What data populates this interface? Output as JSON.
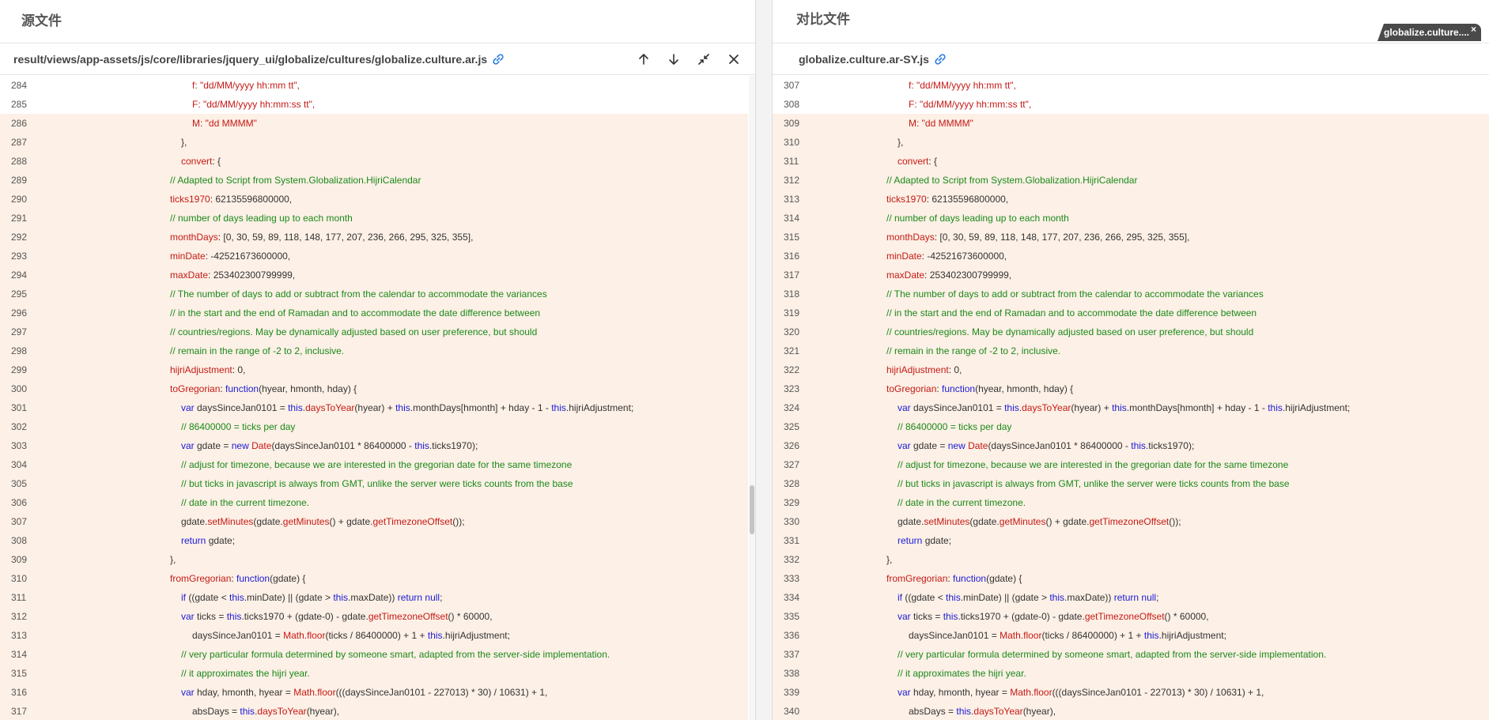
{
  "left": {
    "title": "源文件",
    "file_path": "result/views/app-assets/js/core/libraries/jquery_ui/globalize/cultures/globalize.culture.ar.js",
    "first_line": 284,
    "tooltips": {
      "prev": "上一处差异",
      "next": "下一处差异",
      "collapse": "折叠",
      "close": "关闭"
    }
  },
  "right": {
    "title": "对比文件",
    "file_path": "globalize.culture.ar-SY.js",
    "first_line": 307
  },
  "file_tab": {
    "label": "globalize.culture....",
    "close": "×"
  },
  "colors": {
    "highlight": "#fdf0e6",
    "marker_yellow": "#f2b705",
    "marker_red": "#f0666a",
    "keyword": "#1a1ad6",
    "property": "#c41a16",
    "comment": "#1a8a1a"
  },
  "icons": [
    "link-icon",
    "arrow-up-icon",
    "arrow-down-icon",
    "collapse-icon",
    "close-icon"
  ],
  "lines": [
    {
      "indent": 3,
      "segs": [
        [
          "st",
          "f: \"dd/MM/yyyy hh:mm tt\","
        ]
      ]
    },
    {
      "indent": 3,
      "segs": [
        [
          "st",
          "F: \"dd/MM/yyyy hh:mm:ss tt\","
        ]
      ]
    },
    {
      "indent": 3,
      "segs": [
        [
          "st",
          "M: \"dd MMMM\""
        ]
      ]
    },
    {
      "indent": 2,
      "segs": [
        [
          "pl",
          "},"
        ]
      ]
    },
    {
      "indent": 2,
      "segs": [
        [
          "pr",
          "convert"
        ],
        [
          "pl",
          ": {"
        ]
      ]
    },
    {
      "indent": 1,
      "segs": [
        [
          "cm",
          "// Adapted to Script from System.Globalization.HijriCalendar"
        ]
      ]
    },
    {
      "indent": 1,
      "segs": [
        [
          "pr",
          "ticks1970"
        ],
        [
          "pl",
          ": 62135596800000,"
        ]
      ]
    },
    {
      "indent": 1,
      "segs": [
        [
          "cm",
          "// number of days leading up to each month"
        ]
      ]
    },
    {
      "indent": 1,
      "segs": [
        [
          "pr",
          "monthDays"
        ],
        [
          "pl",
          ": [0, 30, 59, 89, 118, 148, 177, 207, 236, 266, 295, 325, 355],"
        ]
      ]
    },
    {
      "indent": 1,
      "segs": [
        [
          "pr",
          "minDate"
        ],
        [
          "pl",
          ": -42521673600000,"
        ]
      ]
    },
    {
      "indent": 1,
      "segs": [
        [
          "pr",
          "maxDate"
        ],
        [
          "pl",
          ": 253402300799999,"
        ]
      ]
    },
    {
      "indent": 1,
      "segs": [
        [
          "cm",
          "// The number of days to add or subtract from the calendar to accommodate the variances"
        ]
      ]
    },
    {
      "indent": 1,
      "segs": [
        [
          "cm",
          "// in the start and the end of Ramadan and to accommodate the date difference between"
        ]
      ]
    },
    {
      "indent": 1,
      "segs": [
        [
          "cm",
          "// countries/regions. May be dynamically adjusted based on user preference, but should"
        ]
      ]
    },
    {
      "indent": 1,
      "segs": [
        [
          "cm",
          "// remain in the range of -2 to 2, inclusive."
        ]
      ]
    },
    {
      "indent": 1,
      "segs": [
        [
          "pr",
          "hijriAdjustment"
        ],
        [
          "pl",
          ": 0,"
        ]
      ]
    },
    {
      "indent": 1,
      "segs": [
        [
          "pr",
          "toGregorian"
        ],
        [
          "pl",
          ": "
        ],
        [
          "kw",
          "function"
        ],
        [
          "pl",
          "(hyear, hmonth, hday) {"
        ]
      ]
    },
    {
      "indent": 2,
      "segs": [
        [
          "kw",
          "var"
        ],
        [
          "pl",
          " daysSinceJan0101 = "
        ],
        [
          "kw",
          "this"
        ],
        [
          "pl",
          "."
        ],
        [
          "fn",
          "daysToYear"
        ],
        [
          "pl",
          "(hyear) + "
        ],
        [
          "kw",
          "this"
        ],
        [
          "pl",
          ".monthDays[hmonth] + hday - 1 - "
        ],
        [
          "kw",
          "this"
        ],
        [
          "pl",
          ".hijriAdjustment;"
        ]
      ]
    },
    {
      "indent": 2,
      "segs": [
        [
          "cm",
          "// 86400000 = ticks per day"
        ]
      ]
    },
    {
      "indent": 2,
      "segs": [
        [
          "kw",
          "var"
        ],
        [
          "pl",
          " gdate = "
        ],
        [
          "kw",
          "new"
        ],
        [
          "pl",
          " "
        ],
        [
          "fn",
          "Date"
        ],
        [
          "pl",
          "(daysSinceJan0101 * 86400000 - "
        ],
        [
          "kw",
          "this"
        ],
        [
          "pl",
          ".ticks1970);"
        ]
      ]
    },
    {
      "indent": 2,
      "segs": [
        [
          "cm",
          "// adjust for timezone, because we are interested in the gregorian date for the same timezone"
        ]
      ]
    },
    {
      "indent": 2,
      "segs": [
        [
          "cm",
          "// but ticks in javascript is always from GMT, unlike the server were ticks counts from the base"
        ]
      ]
    },
    {
      "indent": 2,
      "segs": [
        [
          "cm",
          "// date in the current timezone."
        ]
      ]
    },
    {
      "indent": 2,
      "segs": [
        [
          "pl",
          "gdate."
        ],
        [
          "fn",
          "setMinutes"
        ],
        [
          "pl",
          "(gdate."
        ],
        [
          "fn",
          "getMinutes"
        ],
        [
          "pl",
          "() + gdate."
        ],
        [
          "fn",
          "getTimezoneOffset"
        ],
        [
          "pl",
          "());"
        ]
      ]
    },
    {
      "indent": 2,
      "segs": [
        [
          "kw",
          "return"
        ],
        [
          "pl",
          " gdate;"
        ]
      ]
    },
    {
      "indent": 1,
      "segs": [
        [
          "pl",
          "},"
        ]
      ]
    },
    {
      "indent": 1,
      "segs": [
        [
          "pr",
          "fromGregorian"
        ],
        [
          "pl",
          ": "
        ],
        [
          "kw",
          "function"
        ],
        [
          "pl",
          "(gdate) {"
        ]
      ]
    },
    {
      "indent": 2,
      "segs": [
        [
          "kw",
          "if"
        ],
        [
          "pl",
          " ((gdate < "
        ],
        [
          "kw",
          "this"
        ],
        [
          "pl",
          ".minDate) || (gdate > "
        ],
        [
          "kw",
          "this"
        ],
        [
          "pl",
          ".maxDate)) "
        ],
        [
          "kw",
          "return"
        ],
        [
          "pl",
          " "
        ],
        [
          "kw",
          "null"
        ],
        [
          "pl",
          ";"
        ]
      ]
    },
    {
      "indent": 2,
      "segs": [
        [
          "kw",
          "var"
        ],
        [
          "pl",
          " ticks = "
        ],
        [
          "kw",
          "this"
        ],
        [
          "pl",
          ".ticks1970 + (gdate-0) - gdate."
        ],
        [
          "fn",
          "getTimezoneOffset"
        ],
        [
          "pl",
          "() * 60000,"
        ]
      ]
    },
    {
      "indent": 3,
      "segs": [
        [
          "pl",
          "daysSinceJan0101 = "
        ],
        [
          "fn",
          "Math.floor"
        ],
        [
          "pl",
          "(ticks / 86400000) + 1 + "
        ],
        [
          "kw",
          "this"
        ],
        [
          "pl",
          ".hijriAdjustment;"
        ]
      ]
    },
    {
      "indent": 2,
      "segs": [
        [
          "cm",
          "// very particular formula determined by someone smart, adapted from the server-side implementation."
        ]
      ]
    },
    {
      "indent": 2,
      "segs": [
        [
          "cm",
          "// it approximates the hijri year."
        ]
      ]
    },
    {
      "indent": 2,
      "segs": [
        [
          "kw",
          "var"
        ],
        [
          "pl",
          " hday, hmonth, hyear = "
        ],
        [
          "fn",
          "Math.floor"
        ],
        [
          "pl",
          "(((daysSinceJan0101 - 227013) * 30) / 10631) + 1,"
        ]
      ]
    },
    {
      "indent": 3,
      "segs": [
        [
          "pl",
          "absDays = "
        ],
        [
          "kw",
          "this"
        ],
        [
          "pl",
          "."
        ],
        [
          "fn",
          "daysToYear"
        ],
        [
          "pl",
          "(hyear),"
        ]
      ]
    }
  ]
}
